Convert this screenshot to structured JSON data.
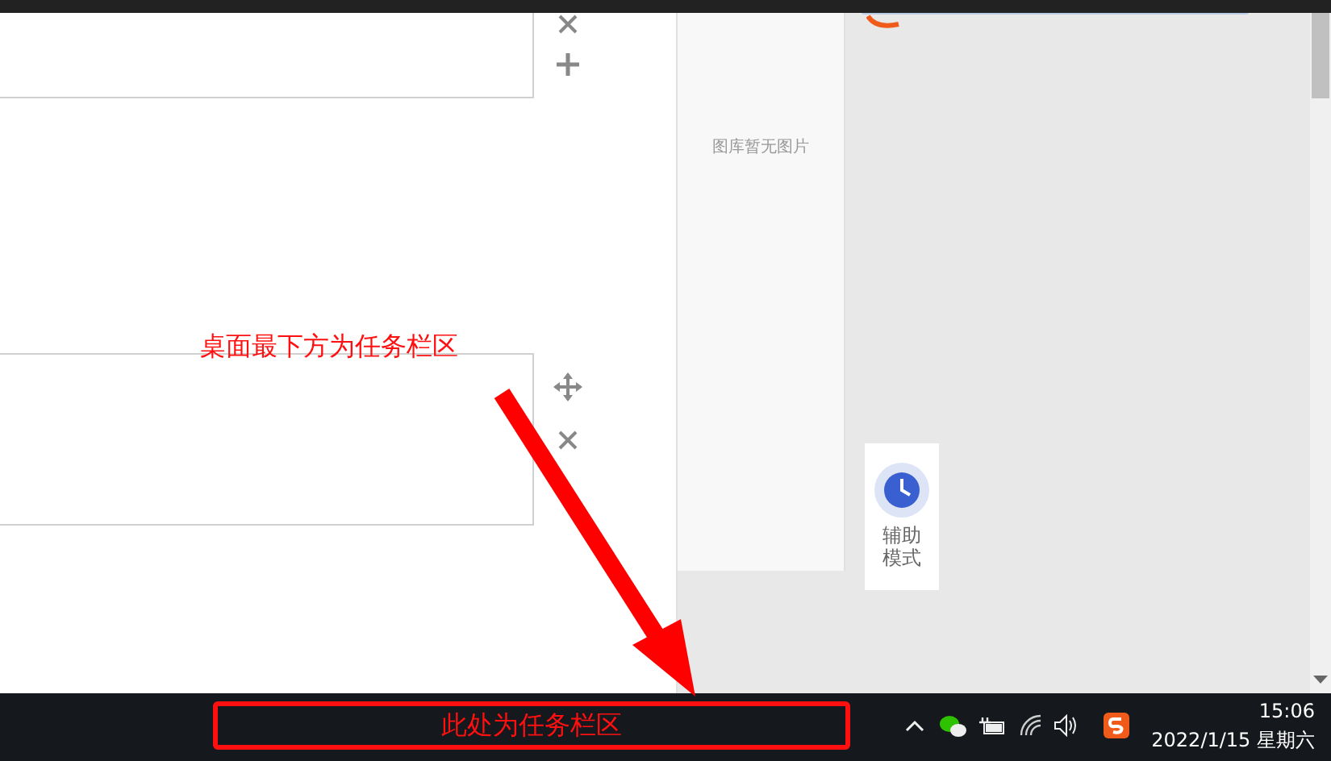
{
  "gallery": {
    "empty_text": "图库暂无图片"
  },
  "assist_button": {
    "label": "辅助模式"
  },
  "annotations": [
    {
      "kind": "callout",
      "text": "桌面最下方为任务栏区"
    },
    {
      "kind": "boxed",
      "text": "此处为任务栏区"
    }
  ],
  "taskbar": {
    "time": "15:06",
    "date": "2022/1/15 星期六"
  }
}
